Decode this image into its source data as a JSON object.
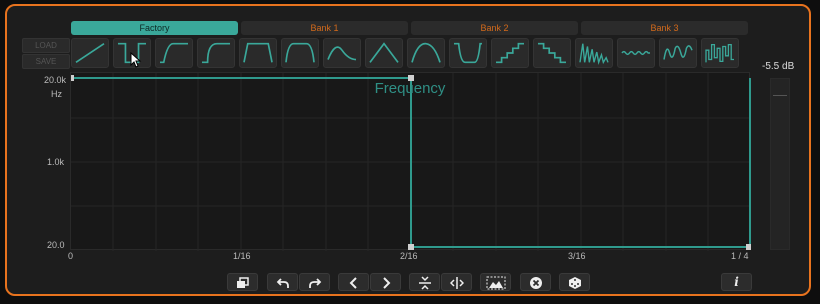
{
  "side_buttons": {
    "load": "LOAD",
    "save": "SAVE"
  },
  "tabs": [
    {
      "label": "Factory",
      "active": true
    },
    {
      "label": "Bank 1",
      "active": false
    },
    {
      "label": "Bank 2",
      "active": false
    },
    {
      "label": "Bank 3",
      "active": false
    }
  ],
  "presets": [
    "ramp-up-icon",
    "pulse-down-icon",
    "slope-plateau-icon",
    "ease-plateau-icon",
    "trapezoid-icon",
    "rounded-trapezoid-icon",
    "sine-arch-icon",
    "triangle-icon",
    "bell-arch-icon",
    "valley-icon",
    "stairs-up-icon",
    "stairs-down-icon",
    "sawtooth-spikes-icon",
    "wavy-line-icon",
    "sine-wave-icon",
    "square-pulses-icon"
  ],
  "graph": {
    "title": "Frequency",
    "y_labels": [
      "20.0k",
      "Hz",
      "1.0k",
      "20.0"
    ],
    "x_labels": [
      "0",
      "1/16",
      "2/16",
      "3/16",
      "1 / 4"
    ]
  },
  "meter": {
    "readout": "-5.5 dB"
  },
  "toolbar": [
    "copy-icon",
    "undo-icon",
    "redo-icon",
    "previous-icon",
    "next-icon",
    "compress-vertical-icon",
    "expand-horizontal-icon",
    "fit-view-icon",
    "clear-icon",
    "randomize-dice-icon"
  ],
  "info_label": "i",
  "colors": {
    "accent": "#3aa89a",
    "border": "#e8731e",
    "tab_text": "#d36a1b"
  }
}
